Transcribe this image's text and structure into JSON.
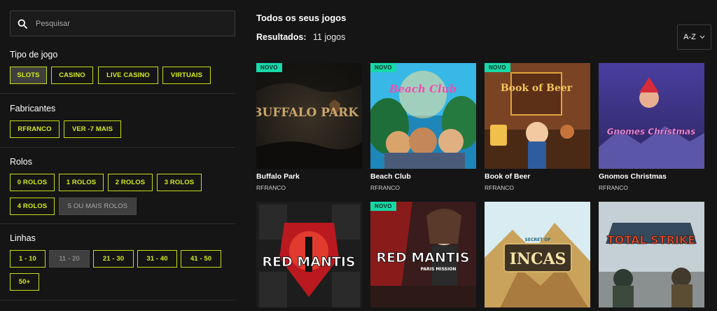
{
  "search": {
    "placeholder": "Pesquisar"
  },
  "filters": {
    "game_type": {
      "title": "Tipo de jogo",
      "options": [
        "SLOTS",
        "CASINO",
        "LIVE CASINO",
        "VIRTUAIS"
      ]
    },
    "manufacturers": {
      "title": "Fabricantes",
      "options": [
        "RFRANCO",
        "VER -7 MAIS"
      ]
    },
    "reels": {
      "title": "Rolos",
      "options": [
        "0 ROLOS",
        "1 ROLOS",
        "2 ROLOS",
        "3 ROLOS",
        "4 ROLOS",
        "5 OU MAIS ROLOS"
      ]
    },
    "lines": {
      "title": "Linhas",
      "options": [
        "1 - 10",
        "11 - 20",
        "21 - 30",
        "31 - 40",
        "41 - 50",
        "50+"
      ]
    }
  },
  "main": {
    "title": "Todos os seus jogos",
    "results_label": "Resultados:",
    "results_count": "11 jogos",
    "sort": "A-Z"
  },
  "games": [
    {
      "title": "Buffalo Park",
      "provider": "RFRANCO",
      "badge": "NOVO",
      "art_text": "BUFFALO PARK"
    },
    {
      "title": "Beach Club",
      "provider": "RFRANCO",
      "badge": "NOVO",
      "art_text": "Beach Club"
    },
    {
      "title": "Book of Beer",
      "provider": "RFRANCO",
      "badge": "NOVO",
      "art_text": "Book of Beer"
    },
    {
      "title": "Gnomos Christmas",
      "provider": "RFRANCO",
      "badge": "",
      "art_text": "Gnomes Christmas"
    },
    {
      "title": "",
      "provider": "",
      "badge": "",
      "art_text": "RED MANTIS"
    },
    {
      "title": "",
      "provider": "",
      "badge": "NOVO",
      "art_text": "RED MANTIS",
      "art_subtext": "PARIS MISSION"
    },
    {
      "title": "",
      "provider": "",
      "badge": "",
      "art_text": "INCAS",
      "art_subtext": "SECRET OF"
    },
    {
      "title": "",
      "provider": "",
      "badge": "",
      "art_text": "TOTAL STRIKE"
    }
  ],
  "colors": {
    "accent": "#d4ec19",
    "badge": "#17d9a8",
    "background": "#151515"
  }
}
